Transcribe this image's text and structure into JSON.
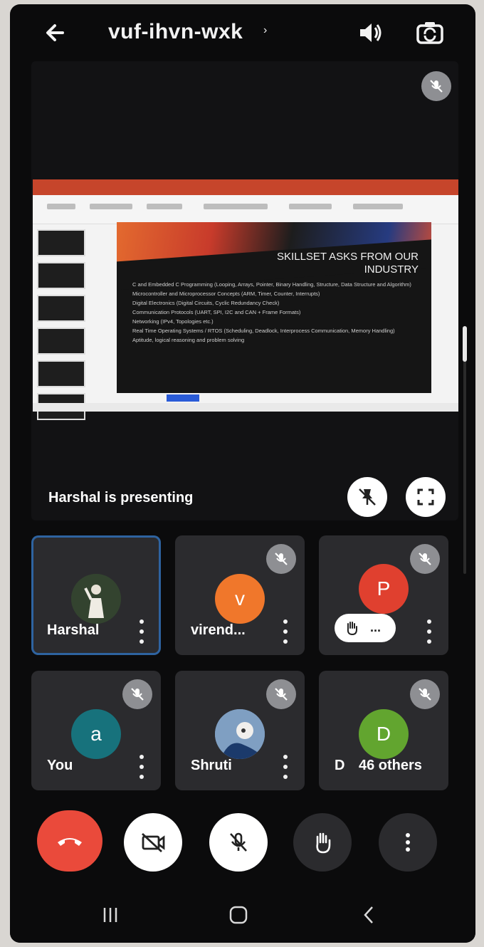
{
  "header": {
    "meeting_code": "vuf-ihvn-wxk",
    "caret": "›",
    "back_icon": "arrow-left-icon",
    "speaker_icon": "speaker-icon",
    "flip_icon": "camera-flip-icon"
  },
  "presentation": {
    "presenting_text": "Harshal is presenting",
    "slide_title": "SKILLSET ASKS FROM OUR INDUSTRY",
    "slide_bullets": [
      "C and Embedded C Programming (Looping, Arrays, Pointer, Binary Handling, Structure, Data Structure and Algorithm)",
      "Microcontroller and Microprocessor Concepts (ARM, Timer, Counter, Interrupts)",
      "Digital Electronics (Digital Circuits, Cyclic Redundancy Check)",
      "Communication Protocols (UART, SPI, I2C and CAN + Frame Formats)",
      "Networking (IPv4, Topologies etc.)",
      "Real Time Operating Systems / RTOS (Scheduling, Deadlock, Interprocess Communication, Memory Handling)",
      "Aptitude, logical reasoning and problem solving"
    ]
  },
  "participants": [
    {
      "name": "Harshal",
      "avatar_type": "photo",
      "muted": false,
      "active": true
    },
    {
      "name": "virend...",
      "initial": "v",
      "color": "#f0772b",
      "muted": true
    },
    {
      "name": "",
      "initial": "P",
      "color": "#e0402f",
      "muted": true,
      "raise_label": "..."
    },
    {
      "name": "You",
      "initial": "a",
      "color": "#17727c",
      "muted": true
    },
    {
      "name": "Shruti",
      "avatar_type": "photo",
      "muted": true
    },
    {
      "name": "46 others",
      "initial": "D",
      "color": "#62a52f",
      "muted": true,
      "prefix": "D"
    }
  ],
  "controls": {
    "end_call_color": "#ea4a3b",
    "items": [
      "end-call",
      "camera-off",
      "mic-off",
      "raise-hand",
      "more-options"
    ]
  },
  "nav": [
    "recents",
    "home",
    "back"
  ]
}
